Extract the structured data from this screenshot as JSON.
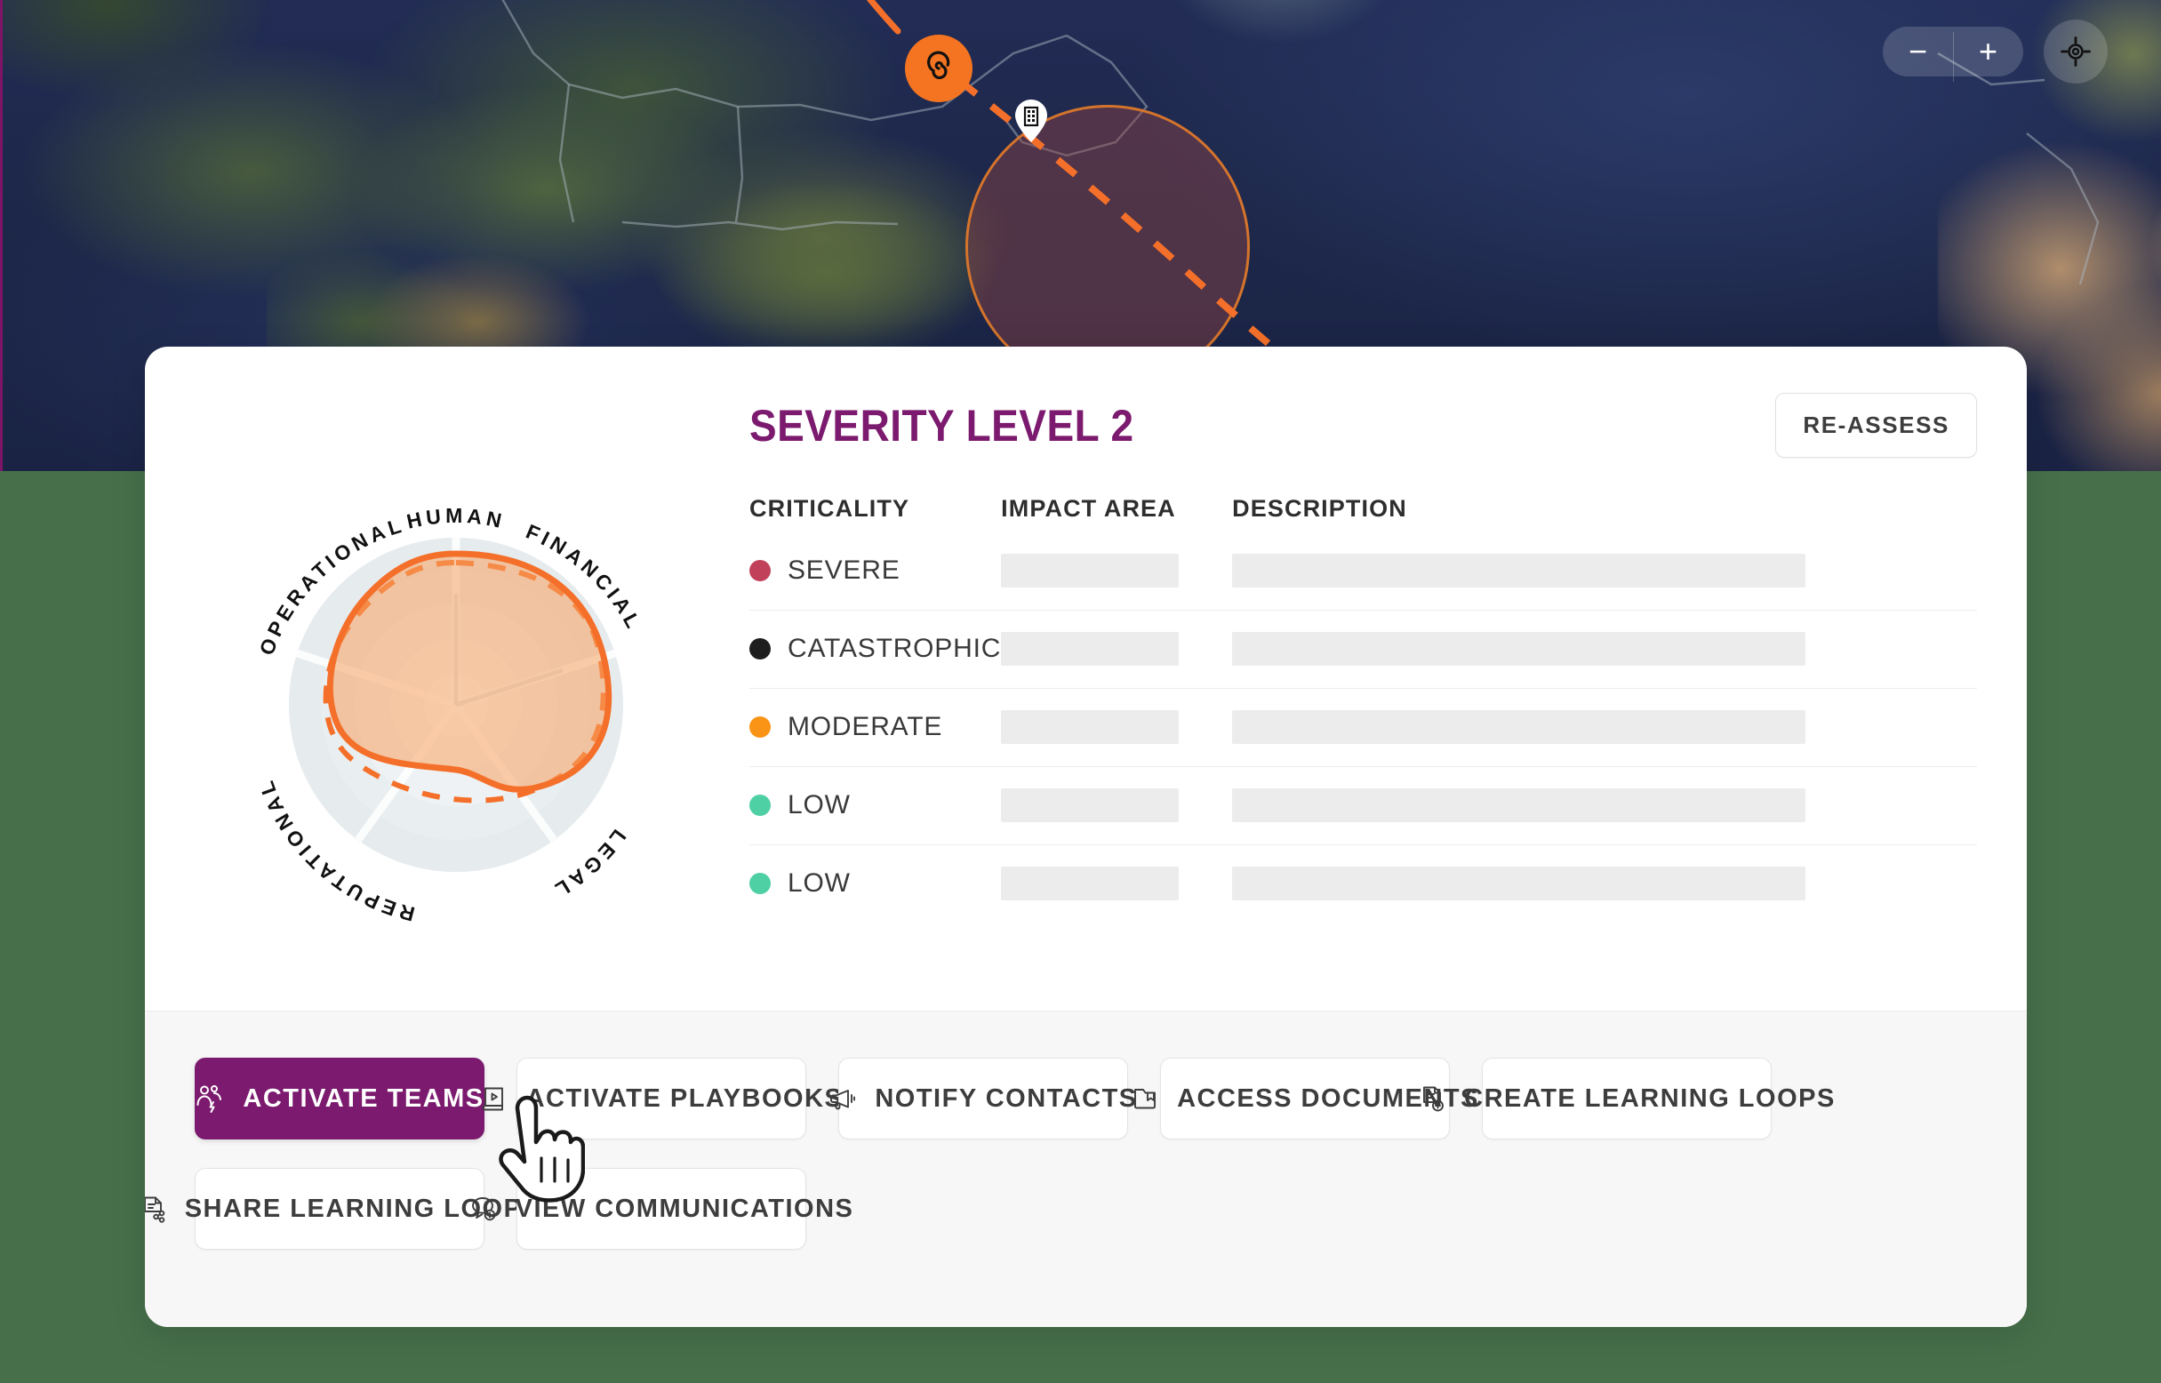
{
  "map": {
    "controls": {
      "zoom_out_label": "−",
      "zoom_in_label": "+",
      "locate_icon": "crosshair-locate-icon"
    },
    "markers": {
      "storm_icon": "hurricane-spiral-icon",
      "facility_icon": "building-pin-icon",
      "impact_zone_label": "impact-radius-circle",
      "forecast_track_label": "forecast-track-dashed"
    },
    "colors": {
      "storm": "#F47421",
      "impact_fill": "rgba(150,70,70,0.42)",
      "impact_stroke": "#D4742C",
      "background_green": "#47704a"
    }
  },
  "card": {
    "title": "SEVERITY LEVEL 2",
    "reassess_label": "RE-ASSESS",
    "accent_purple": "#7B1A6E",
    "radar": {
      "axes": [
        "HUMAN",
        "FINANCIAL",
        "LEGAL",
        "REPUTATIONAL",
        "OPERATIONAL"
      ],
      "series": [
        {
          "name": "current",
          "style": "solid",
          "color": "#F4702A"
        },
        {
          "name": "previous",
          "style": "dashed",
          "color": "#F4702A"
        }
      ]
    },
    "table": {
      "headers": {
        "criticality": "CRITICALITY",
        "impact_area": "IMPACT AREA",
        "description": "DESCRIPTION"
      },
      "rows": [
        {
          "criticality": "SEVERE",
          "dot_color": "#C2415A",
          "impact_area": "",
          "description": ""
        },
        {
          "criticality": "CATASTROPHIC",
          "dot_color": "#1E1E1E",
          "impact_area": "",
          "description": ""
        },
        {
          "criticality": "MODERATE",
          "dot_color": "#F99416",
          "impact_area": "",
          "description": ""
        },
        {
          "criticality": "LOW",
          "dot_color": "#4ED0A4",
          "impact_area": "",
          "description": ""
        },
        {
          "criticality": "LOW",
          "dot_color": "#4ED0A4",
          "impact_area": "",
          "description": ""
        }
      ]
    }
  },
  "footer": {
    "buttons": [
      {
        "label": "ACTIVATE TEAMS",
        "icon": "users-lightning-icon",
        "primary": true
      },
      {
        "label": "ACTIVATE PLAYBOOKS",
        "icon": "book-play-icon",
        "primary": false
      },
      {
        "label": "NOTIFY CONTACTS",
        "icon": "megaphone-icon",
        "primary": false
      },
      {
        "label": "ACCESS DOCUMENTS",
        "icon": "folder-bookmark-icon",
        "primary": false
      },
      {
        "label": "CREATE LEARNING LOOPS",
        "icon": "document-plus-icon",
        "primary": false
      },
      {
        "label": "SHARE LEARNING LOOPS",
        "icon": "document-share-icon",
        "primary": false
      },
      {
        "label": "VIEW COMMUNICATIONS",
        "icon": "chat-plus-icon",
        "primary": false
      }
    ]
  },
  "cursor": {
    "icon": "pointing-hand-cursor"
  }
}
